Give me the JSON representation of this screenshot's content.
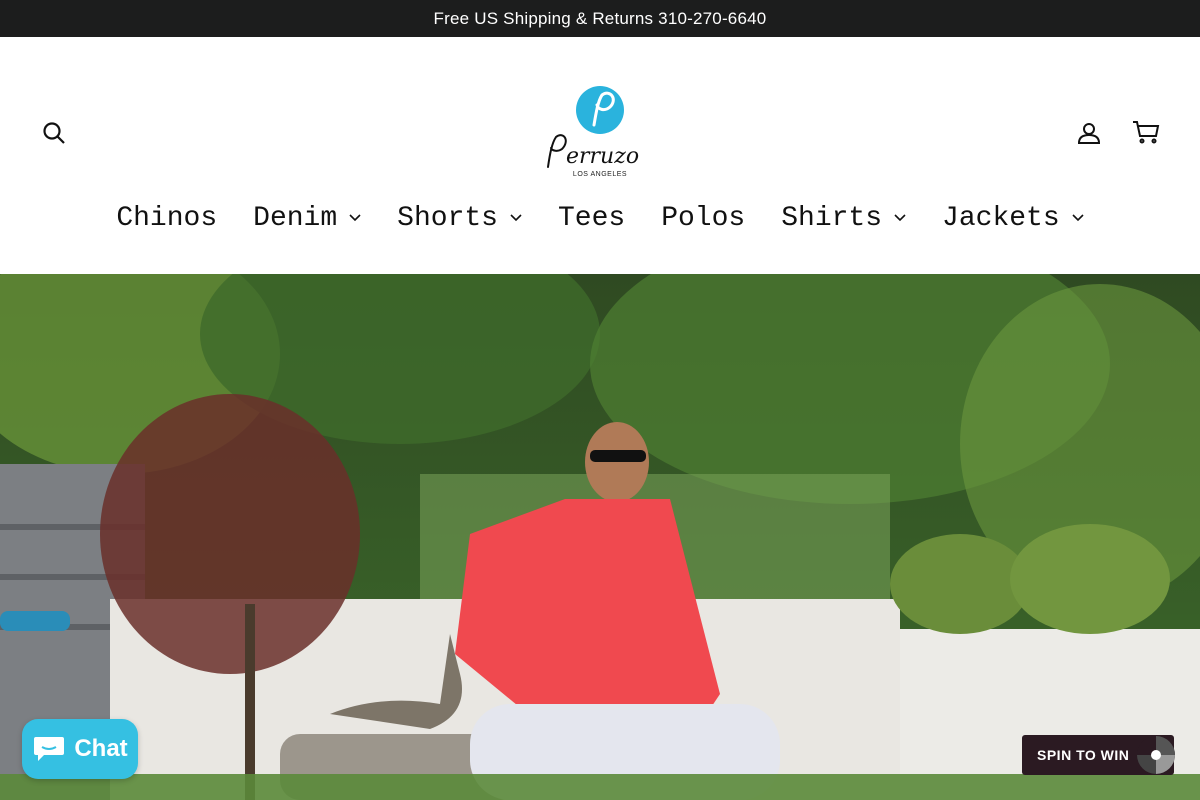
{
  "announcement": {
    "text": "Free US Shipping & Returns 310-270-6640"
  },
  "header": {
    "logo": {
      "brand": "Perruzo",
      "sub": "LOS ANGELES",
      "accent": "#2ab3dd"
    },
    "icons": {
      "search": "search-icon",
      "account": "user-icon",
      "cart": "cart-icon"
    }
  },
  "nav": {
    "items": [
      {
        "label": "Chinos",
        "dropdown": false
      },
      {
        "label": "Denim",
        "dropdown": true
      },
      {
        "label": "Shorts",
        "dropdown": true
      },
      {
        "label": "Tees",
        "dropdown": false
      },
      {
        "label": "Polos",
        "dropdown": false
      },
      {
        "label": "Shirts",
        "dropdown": true
      },
      {
        "label": "Jackets",
        "dropdown": true
      }
    ]
  },
  "chat": {
    "label": "Chat",
    "color": "#35c0e2"
  },
  "spin": {
    "label": "SPIN TO WIN"
  }
}
